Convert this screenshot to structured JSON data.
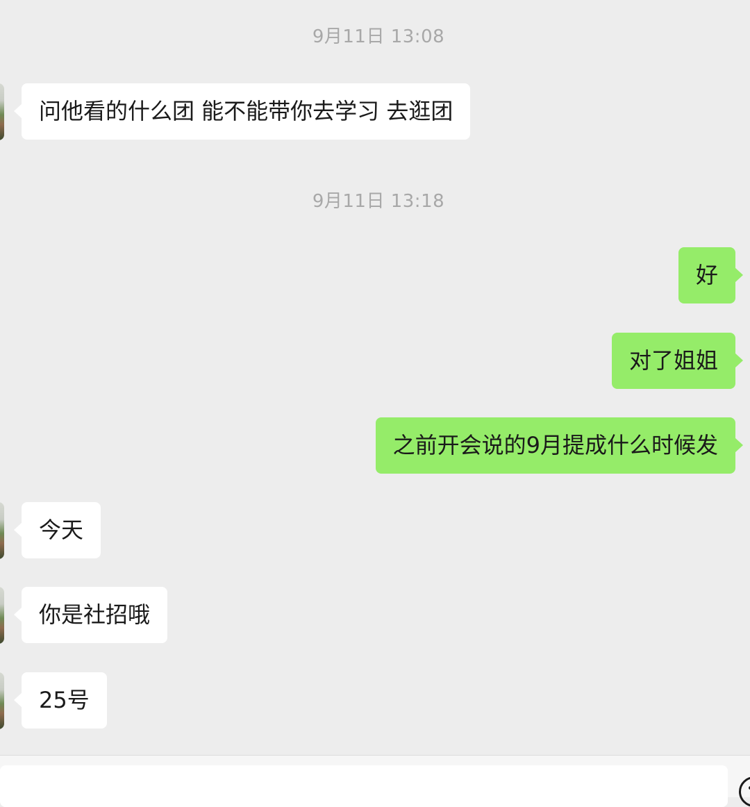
{
  "timestamps": [
    "9月11日 13:08",
    "9月11日 13:18"
  ],
  "messages": [
    {
      "side": "in",
      "text": "问他看的什么团 能不能带你去学习 去逛团"
    },
    {
      "side": "out",
      "text": "好"
    },
    {
      "side": "out",
      "text": "对了姐姐"
    },
    {
      "side": "out",
      "text": "之前开会说的9月提成什么时候发"
    },
    {
      "side": "in",
      "text": "今天"
    },
    {
      "side": "in",
      "text": "你是社招哦"
    },
    {
      "side": "in",
      "text": "25号"
    }
  ],
  "colors": {
    "background": "#ededed",
    "incoming_bubble": "#ffffff",
    "outgoing_bubble": "#95ec69",
    "timestamp": "#a8a8a8"
  },
  "icons": {
    "composer_right": "emoji-icon"
  }
}
